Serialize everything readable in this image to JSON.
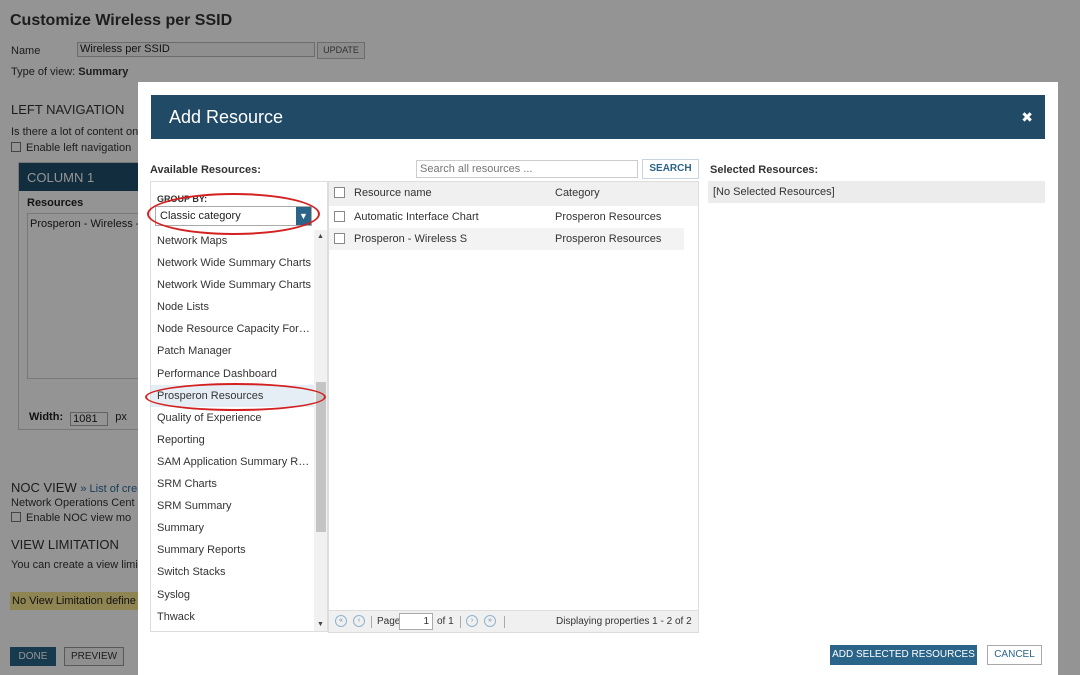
{
  "background": {
    "page_title": "Customize Wireless per SSID",
    "name_label": "Name",
    "name_value": "Wireless per SSID",
    "update_label": "UPDATE",
    "type_of_view_label": "Type of view:",
    "type_of_view_value": "Summary",
    "left_nav_heading": "LEFT NAVIGATION",
    "left_nav_question": "Is there a lot of content on",
    "left_nav_checkbox": "Enable left navigation",
    "column_title": "COLUMN 1",
    "resources_label": "Resources",
    "resources_item": "Prosperon - Wireless -",
    "width_label": "Width:",
    "width_value": "1081",
    "width_unit": "px",
    "noc_heading": "NOC VIEW",
    "noc_link": "» List of creat",
    "noc_text": "Network Operations Cent",
    "noc_checkbox": "Enable NOC view mo",
    "view_limit_heading": "VIEW LIMITATION",
    "view_limit_text": "You can create a view limi",
    "no_limit_text": "No View Limitation define",
    "done_label": "DONE",
    "preview_label": "PREVIEW"
  },
  "modal": {
    "title": "Add Resource",
    "close_icon": "close-icon",
    "available_label": "Available Resources:",
    "search_placeholder": "Search all resources ...",
    "search_button": "SEARCH",
    "selected_label": "Selected Resources:",
    "group_by_label": "GROUP BY:",
    "group_by_value": "Classic category",
    "groups": [
      "Network Maps",
      "Network Wide Summary Charts",
      "Network Wide Summary Charts",
      "Node Lists",
      "Node Resource Capacity Forecasting",
      "Patch Manager",
      "Performance Dashboard",
      "Prosperon Resources",
      "Quality of Experience",
      "Reporting",
      "SAM Application Summary Reports",
      "SRM Charts",
      "SRM Summary",
      "Summary",
      "Summary Reports",
      "Switch Stacks",
      "Syslog",
      "Thwack"
    ],
    "selected_group_index": 7,
    "grid": {
      "columns": [
        "Resource name",
        "Category"
      ],
      "rows": [
        {
          "name": "Automatic Interface Chart",
          "category": "Prosperon Resources"
        },
        {
          "name": "Prosperon - Wireless S",
          "category": "Prosperon Resources"
        }
      ]
    },
    "pager": {
      "page_label": "Page",
      "page_value": "1",
      "of_label": "of 1",
      "displaying": "Displaying properties 1 - 2 of 2"
    },
    "selected_empty": "[No Selected Resources]",
    "add_button": "ADD SELECTED RESOURCES",
    "cancel_button": "CANCEL"
  },
  "colors": {
    "header": "#204a66",
    "primary_button": "#2a6489",
    "annotation": "#d32020"
  }
}
